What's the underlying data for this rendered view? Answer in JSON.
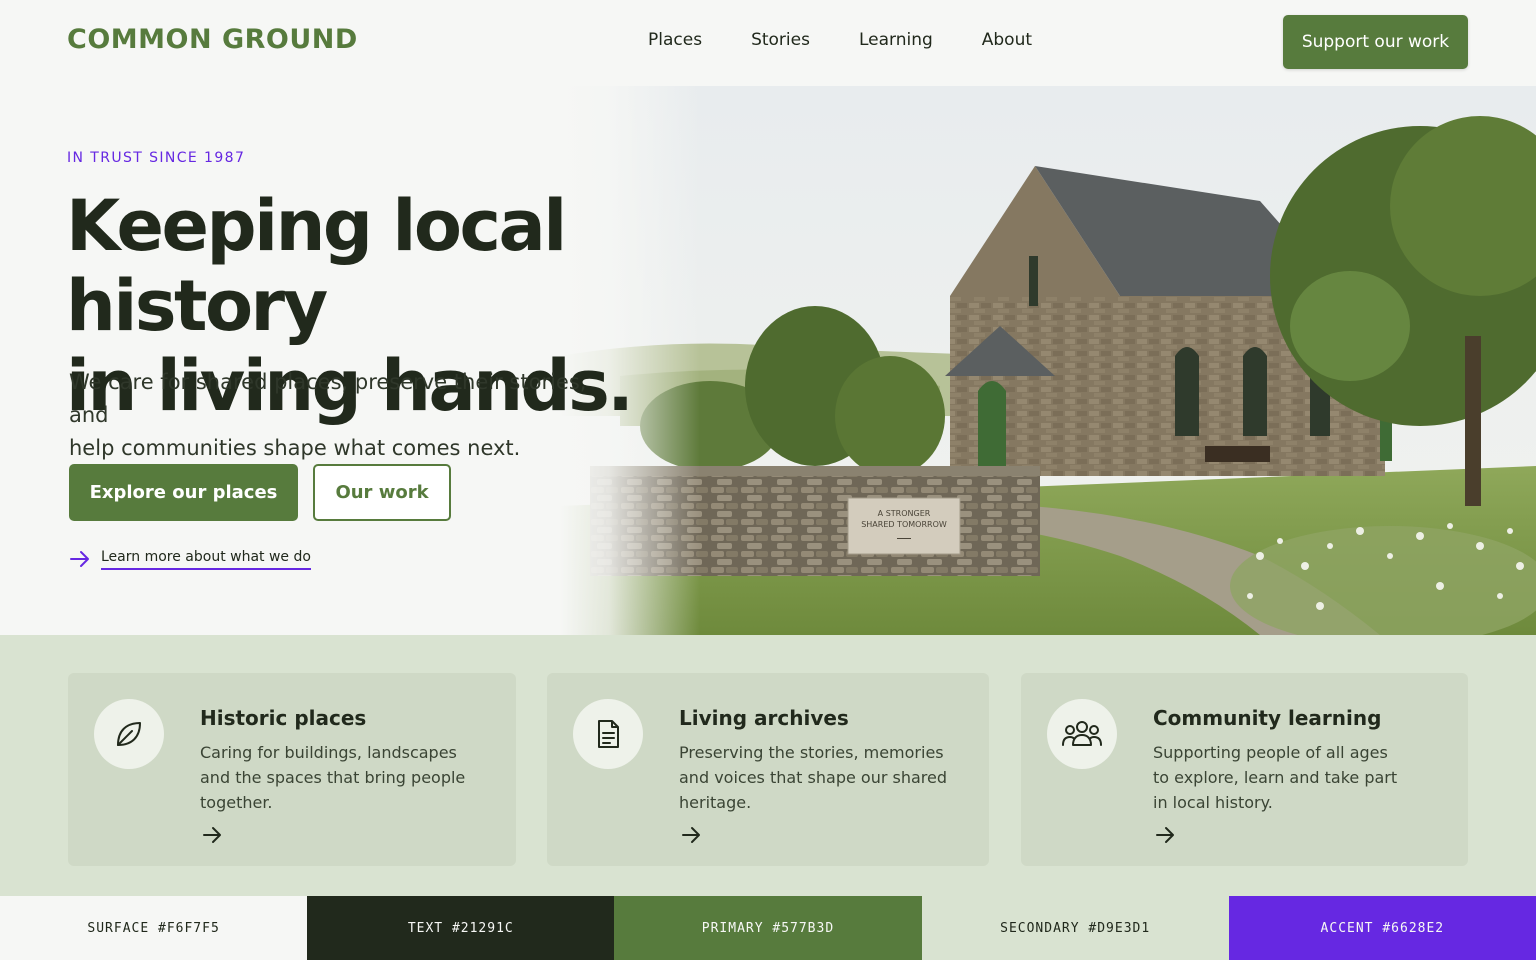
{
  "brand": {
    "logo_text": "COMMON GROUND"
  },
  "nav": {
    "items": [
      {
        "label": "Places"
      },
      {
        "label": "Stories"
      },
      {
        "label": "Learning"
      },
      {
        "label": "About"
      }
    ],
    "cta_label": "Support our work"
  },
  "hero": {
    "eyebrow": "IN TRUST SINCE 1987",
    "headline_line1": "Keeping local history",
    "headline_line2": "in living hands.",
    "subhead_line1": "We care for shared places, preserve their stories, and",
    "subhead_line2": "help communities shape what comes next.",
    "primary_button": "Explore our places",
    "secondary_button": "Our work",
    "learn_link": "Learn more about what we do",
    "image_sign_line1": "A STRONGER",
    "image_sign_line2": "SHARED TOMORROW"
  },
  "features": [
    {
      "title": "Historic places",
      "desc_lines": [
        "Caring for buildings, landscapes",
        "and the spaces that bring people",
        "together."
      ],
      "icon": "leaf-icon"
    },
    {
      "title": "Living archives",
      "desc_lines": [
        "Preserving the stories, memories",
        "and voices that shape our shared",
        "heritage."
      ],
      "icon": "document-icon"
    },
    {
      "title": "Community learning",
      "desc_lines": [
        "Supporting people of all ages",
        "to explore, learn and take part",
        "in local history."
      ],
      "icon": "people-icon"
    }
  ],
  "palette": [
    {
      "label": "SURFACE #F6F7F5",
      "color": "#F6F7F5",
      "text_color": "#21291C"
    },
    {
      "label": "TEXT #21291C",
      "color": "#21291C",
      "text_color": "#F6F7F5"
    },
    {
      "label": "PRIMARY #577B3D",
      "color": "#577B3D",
      "text_color": "#F6F7F5"
    },
    {
      "label": "SECONDARY #D9E3D1",
      "color": "#D9E3D1",
      "text_color": "#21291C"
    },
    {
      "label": "ACCENT #6628E2",
      "color": "#6628E2",
      "text_color": "#F6F7F5"
    }
  ],
  "colors": {
    "primary": "#577B3D",
    "text": "#21291C",
    "surface": "#F6F7F5",
    "secondary": "#D9E3D1",
    "accent": "#6628E2"
  }
}
